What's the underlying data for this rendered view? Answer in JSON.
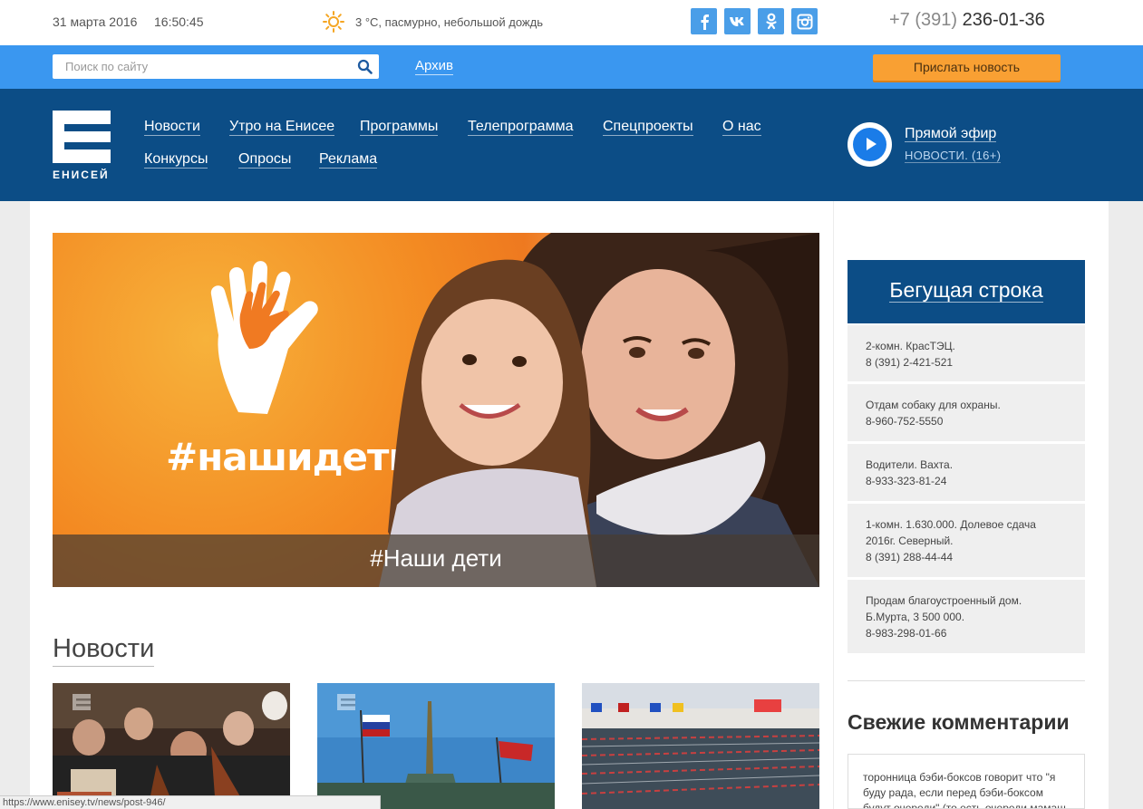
{
  "topbar": {
    "date": "31 марта 2016",
    "time": "16:50:45",
    "weather": "3 °C, пасмурно, небольшой дождь",
    "weather_icon": "sun-icon",
    "social": [
      {
        "name": "facebook-icon",
        "glyph": "f"
      },
      {
        "name": "vk-icon",
        "glyph": "vk"
      },
      {
        "name": "odnoklassniki-icon",
        "glyph": "ok"
      },
      {
        "name": "instagram-icon",
        "glyph": "ig"
      }
    ],
    "phone_code": "+7 (391)",
    "phone_number": " 236-01-36"
  },
  "searchbar": {
    "placeholder": "Поиск по сайту",
    "archive": "Архив",
    "send_news": "Прислать новость"
  },
  "nav": {
    "logo_text": "ЕНИСЕЙ",
    "items": [
      "Новости",
      "Утро на Енисее",
      "Программы",
      "Телепрограмма",
      "Спецпроекты",
      "О нас",
      "Конкурсы",
      "Опросы",
      "Реклама"
    ],
    "live_title": "Прямой эфир",
    "live_sub": "НОВОСТИ. (16+)"
  },
  "hero": {
    "art_text": "#нашидети",
    "caption": "#Наши дети"
  },
  "news": {
    "heading": "Новости"
  },
  "sidebar": {
    "ticker_title": "Бегущая строка",
    "ticker": [
      {
        "lines": [
          "2-комн. КрасТЭЦ.",
          "8 (391) 2-421-521"
        ]
      },
      {
        "lines": [
          "Отдам собаку для охраны.",
          "8-960-752-5550"
        ]
      },
      {
        "lines": [
          "Водители. Вахта.",
          "8-933-323-81-24"
        ]
      },
      {
        "lines": [
          "1-комн. 1.630.000. Долевое сдача",
          "2016г. Северный.",
          "8 (391) 288-44-44"
        ]
      },
      {
        "lines": [
          "Продам благоустроенный дом.",
          "Б.Мурта, 3 500 000.",
          "8-983-298-01-66"
        ]
      }
    ],
    "comments_title": "Свежие комментарии",
    "comment_text": "торонница бэби-боксов говорит что \"я буду рада, если перед бэби-боксом будут очереди\" (то есть очереди мамаш"
  },
  "statusbar": {
    "url": "https://www.enisey.tv/news/post-946/"
  },
  "colors": {
    "accent_blue": "#3a97f0",
    "nav_dark": "#0c4d86",
    "button_orange": "#f9a033"
  }
}
